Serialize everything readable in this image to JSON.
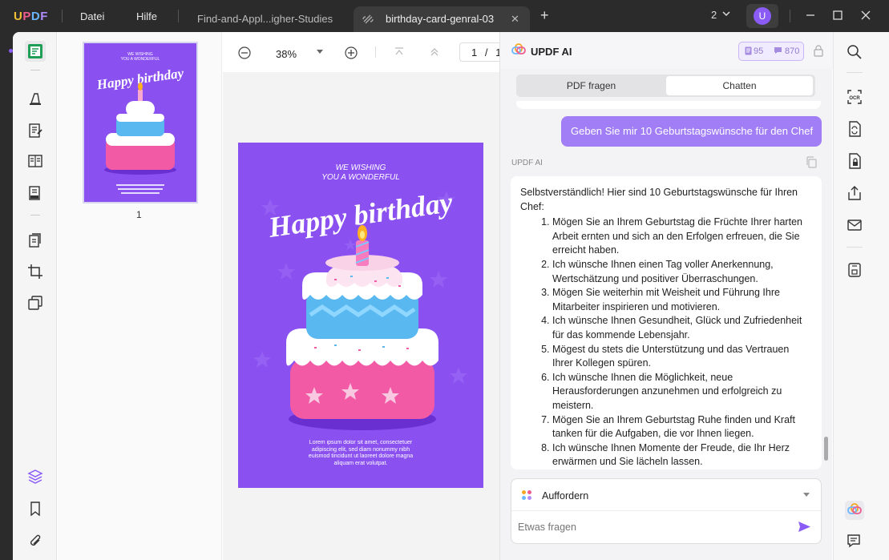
{
  "titlebar": {
    "logo": "UPDF",
    "menu": [
      "Datei",
      "Hilfe"
    ],
    "tabs": [
      {
        "label": "Find-and-Appl...igher-Studies"
      },
      {
        "label": "birthday-card-genral-03"
      }
    ],
    "page_count": "2",
    "avatar_letter": "U"
  },
  "viewer": {
    "zoom": "38%",
    "page_current": "1",
    "page_sep": "/",
    "page_total": "1"
  },
  "thumbnails": {
    "page_label": "1"
  },
  "card": {
    "line1": "WE WISHING",
    "line2": "YOU A WONDERFUL",
    "headline": "Happy birthday",
    "footer": "Lorem ipsum dolor sit amet, consectetuer adipiscing elit, sed diam nonummy nibh euismod tincidunt ut laoreet dolore magna aliquam erat volutpat."
  },
  "ai": {
    "title": "UPDF AI",
    "credits_a": "95",
    "credits_b": "870",
    "tab_pdf": "PDF fragen",
    "tab_chat": "Chatten",
    "user_message": "Geben Sie mir 10 Geburtstagswünsche für den Chef",
    "ai_label": "UPDF AI",
    "reply_intro": "Selbstverständlich! Hier sind 10 Geburtstagswünsche für Ihren Chef:",
    "reply_items": [
      "Mögen Sie an Ihrem Geburtstag die Früchte Ihrer harten Arbeit ernten und sich an den Erfolgen erfreuen, die Sie erreicht haben.",
      "Ich wünsche Ihnen einen Tag voller Anerkennung, Wertschätzung und positiver Überraschungen.",
      "Mögen Sie weiterhin mit Weisheit und Führung Ihre Mitarbeiter inspirieren und motivieren.",
      "Ich wünsche Ihnen Gesundheit, Glück und Zufriedenheit für das kommende Lebensjahr.",
      "Mögest du stets die Unterstützung und das Vertrauen Ihrer Kollegen spüren.",
      "Ich wünsche Ihnen die Möglichkeit, neue Herausforderungen anzunehmen und erfolgreich zu meistern.",
      "Mögen Sie an Ihrem Geburtstag Ruhe finden und Kraft tanken für die Aufgaben, die vor Ihnen liegen.",
      "Ich wünsche Ihnen Momente der Freude, die Ihr Herz erwärmen und Sie lächeln lassen."
    ],
    "prompt_label": "Auffordern",
    "input_placeholder": "Etwas fragen"
  },
  "colors": {
    "accent": "#8a5cf5",
    "card_purple": "#8a50f0",
    "user_bubble": "#a17ef5"
  }
}
